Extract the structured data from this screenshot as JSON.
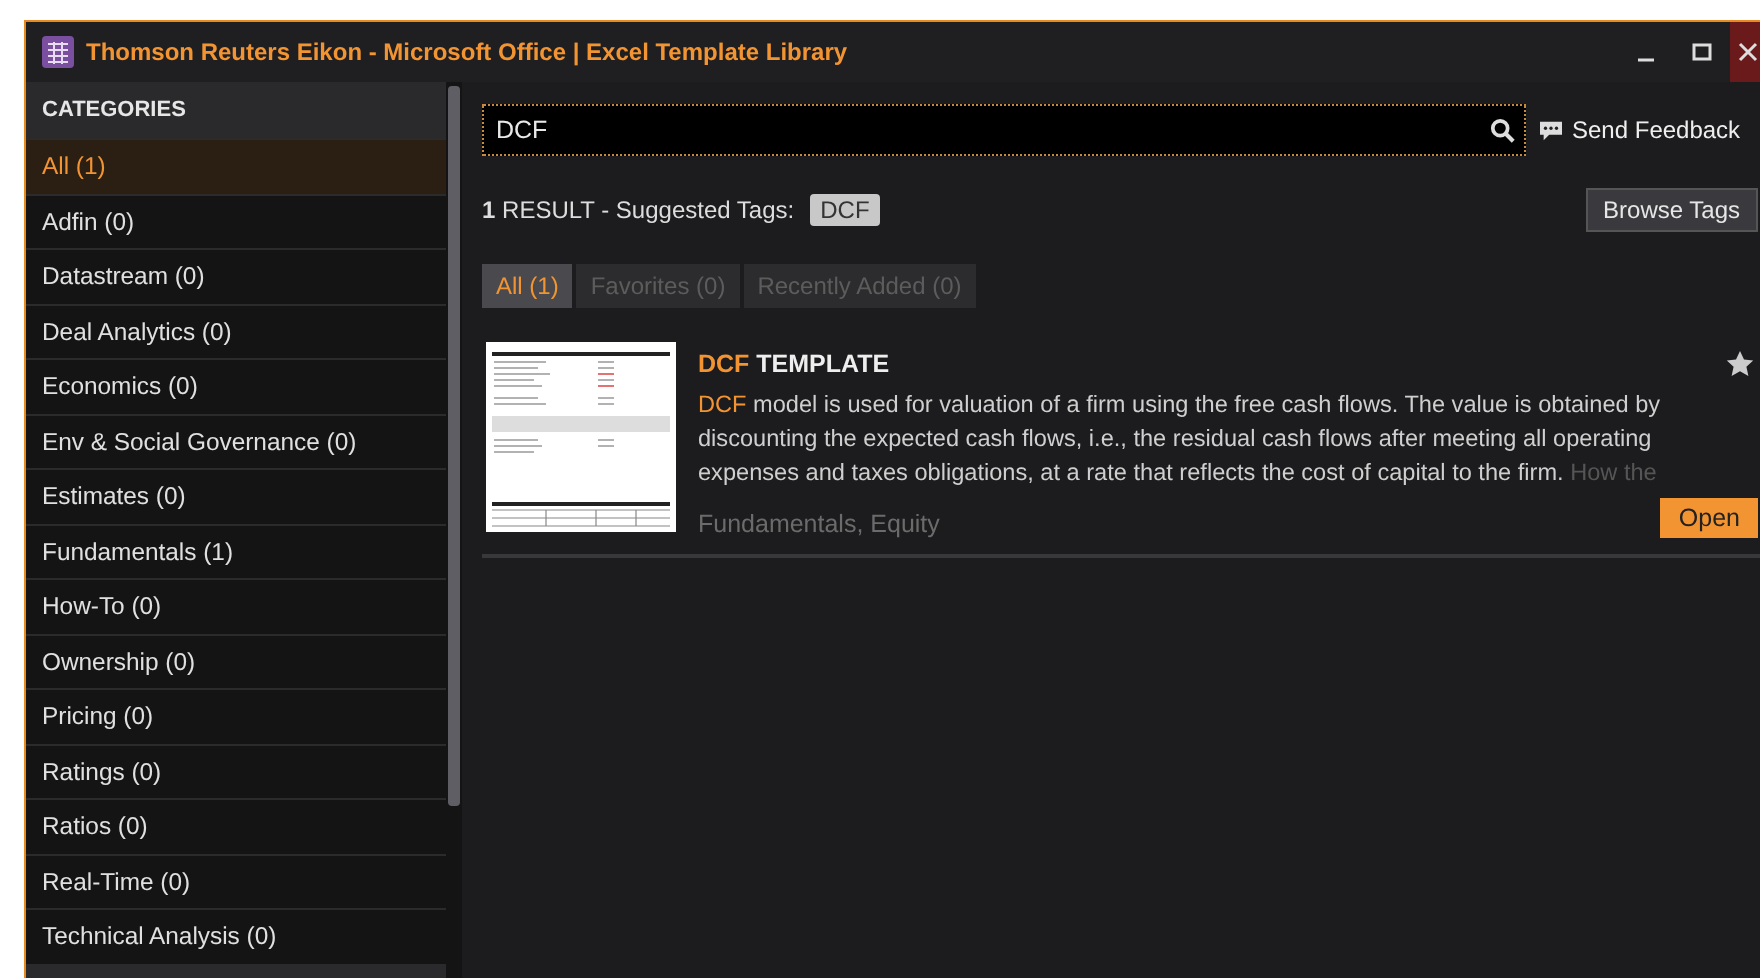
{
  "window": {
    "title": "Thomson Reuters Eikon - Microsoft Office | Excel Template Library"
  },
  "sidebar": {
    "heading": "CATEGORIES",
    "items": [
      {
        "label": "All (1)",
        "selected": true
      },
      {
        "label": "Adfin (0)",
        "selected": false
      },
      {
        "label": "Datastream (0)",
        "selected": false
      },
      {
        "label": "Deal Analytics (0)",
        "selected": false
      },
      {
        "label": "Economics (0)",
        "selected": false
      },
      {
        "label": "Env & Social Governance (0)",
        "selected": false
      },
      {
        "label": "Estimates (0)",
        "selected": false
      },
      {
        "label": "Fundamentals (1)",
        "selected": false
      },
      {
        "label": "How-To (0)",
        "selected": false
      },
      {
        "label": "Ownership (0)",
        "selected": false
      },
      {
        "label": "Pricing (0)",
        "selected": false
      },
      {
        "label": "Ratings (0)",
        "selected": false
      },
      {
        "label": "Ratios (0)",
        "selected": false
      },
      {
        "label": "Real-Time (0)",
        "selected": false
      },
      {
        "label": "Technical Analysis (0)",
        "selected": false
      }
    ]
  },
  "search": {
    "value": "DCF"
  },
  "send_feedback": "Send Feedback",
  "results": {
    "count": "1",
    "label": "RESULT - Suggested Tags:",
    "tags": [
      "DCF"
    ]
  },
  "browse_tags": "Browse Tags",
  "filters": [
    {
      "label": "All (1)",
      "selected": true
    },
    {
      "label": "Favorites (0)",
      "selected": false
    },
    {
      "label": "Recently Added (0)",
      "selected": false
    }
  ],
  "templates": [
    {
      "title_highlight": "DCF",
      "title": "TEMPLATE",
      "description_highlight": "DCF",
      "description": " model is used for valuation of a firm using the free cash flows. The value is obtained by discounting the expected cash flows, i.e., the residual cash flows after meeting all operating expenses and taxes obligations, at a rate that reflects the cost of capital to the firm.",
      "description_faded": "How the",
      "tags": "Fundamentals, Equity",
      "favorite": false,
      "action": "Open"
    }
  ]
}
